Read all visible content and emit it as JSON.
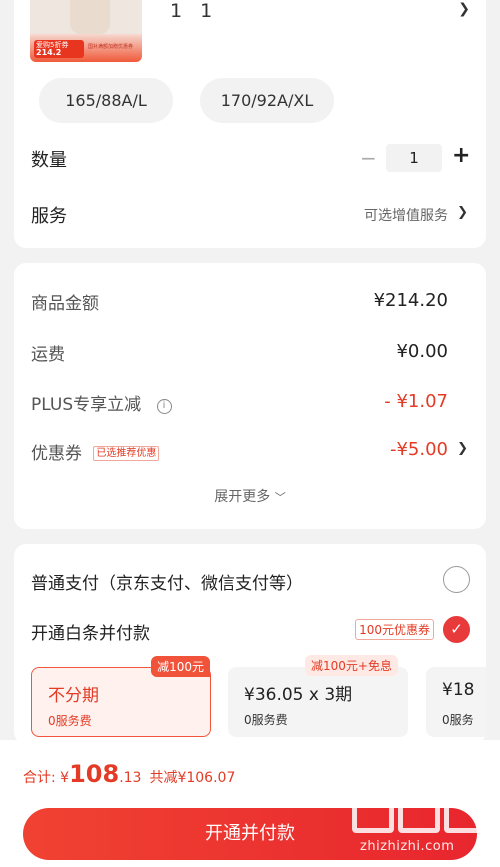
{
  "product": {
    "count_text": "1 1",
    "thumb_price": "214.2",
    "thumb_tag_text": "爱购5折券",
    "thumb_small_text": "国补满额加赠优惠券"
  },
  "sizes": [
    "165/88A/L",
    "170/92A/XL"
  ],
  "quantity": {
    "label": "数量",
    "value": "1",
    "minus": "−",
    "plus": "+"
  },
  "service": {
    "label": "服务",
    "value": "可选增值服务"
  },
  "price": {
    "goods_label": "商品金额",
    "goods_value": "¥214.20",
    "shipping_label": "运费",
    "shipping_value": "¥0.00",
    "plus_label": "PLUS专享立减",
    "plus_value": "- ¥1.07",
    "coupon_label": "优惠券",
    "coupon_tag": "已选推荐优惠",
    "coupon_value": "-¥5.00",
    "expand": "展开更多"
  },
  "payment": {
    "normal_label": "普通支付（京东支付、微信支付等）",
    "baitiao_label": "开通白条并付款",
    "voucher_tag": "100元优惠券",
    "plans": [
      {
        "title": "不分期",
        "sub": "0服务费",
        "badge": "减100元"
      },
      {
        "title": "¥36.05 x 3期",
        "sub": "0服务费",
        "badge": "减100元+免息"
      },
      {
        "title": "¥18",
        "sub": "0服务",
        "badge": ""
      }
    ]
  },
  "footer": {
    "total_label": "合计: ¥",
    "total_int": "108",
    "total_dec": ".13",
    "reduce_text": "共减¥106.07",
    "cta_label": "开通并付款",
    "watermark_text": "zhizhizhi.com"
  },
  "colors": {
    "accent": "#e33b26",
    "cta": "#e8262e",
    "background": "#f2f2f2"
  }
}
